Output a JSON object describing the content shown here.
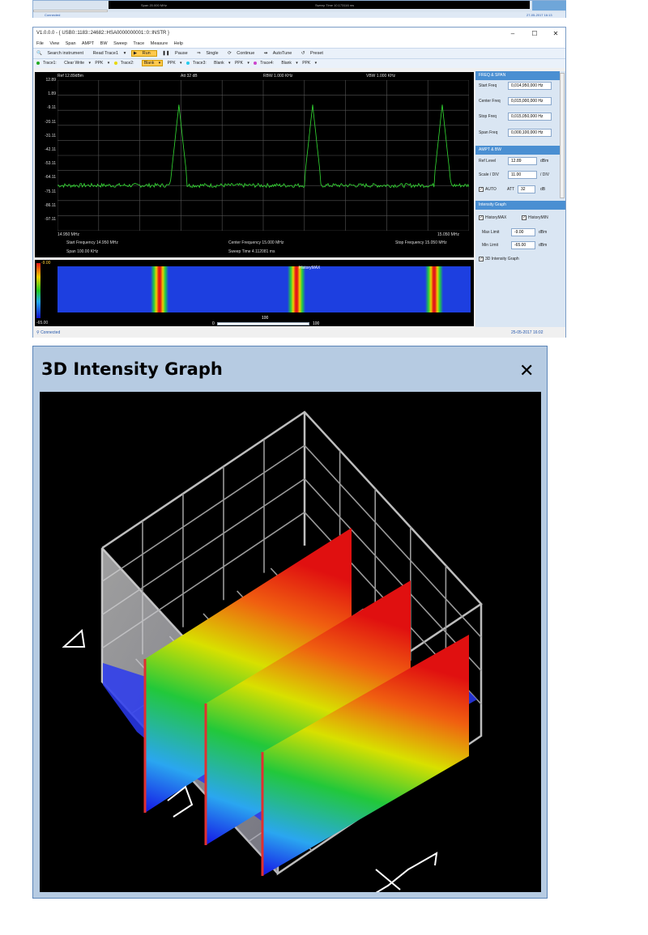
{
  "strip": {
    "span_text": "Span 20.000 MHz",
    "sweep_text": "Sweep Time 10.173116 ms",
    "connected": "Connected",
    "datetime": "27-05-2017 16:13"
  },
  "window": {
    "title": "V1.0.0.0  -  { USB0::1183::24682::HSA0000000001::0::INSTR }",
    "minimize": "–",
    "maximize": "☐",
    "close": "✕"
  },
  "menu": [
    "File",
    "View",
    "Span",
    "AMPT",
    "BW",
    "Sweep",
    "Trace",
    "Measure",
    "Help"
  ],
  "toolbar": {
    "search": "Search instrument",
    "read": "Read Trace1",
    "run": "Run",
    "pause": "Pause",
    "single": "Single",
    "continue": "Continue",
    "autotune": "AutoTune",
    "preset": "Preset"
  },
  "traces": [
    {
      "label": "Trace1:",
      "mode": "Clear Write",
      "det": "PPK",
      "color": "#22aa22"
    },
    {
      "label": "Trace2:",
      "mode": "Blank",
      "det": "PPK",
      "color": "#e8d800"
    },
    {
      "label": "Trace3:",
      "mode": "Blank",
      "det": "PPK",
      "color": "#22ccee"
    },
    {
      "label": "Trace4:",
      "mode": "Blank",
      "det": "PPK",
      "color": "#cc44cc"
    }
  ],
  "spectrum": {
    "ref": "Ref 12.89dBm",
    "att": "Att  32 dB",
    "rbw": "RBW 1.000 KHz",
    "vbw": "VBW 1.000 KHz",
    "y_labels": [
      "12.89",
      "1.89",
      "-9.11",
      "-20.11",
      "-31.11",
      "-42.11",
      "-53.11",
      "-64.11",
      "-75.11",
      "-86.11",
      "-97.11"
    ],
    "x_start": "14.950 MHz",
    "x_stop": "15.050 MHz",
    "start_freq": "Start Frequency  14.950 MHz",
    "span": "Span  100.00 KHz",
    "center_freq": "Center Frequency  15.000 MHz",
    "sweep_time": "Sweep Time  4.112081 ms",
    "stop_freq": "Stop Frequency  15.050 MHz"
  },
  "waterfall": {
    "max_label": "-9.00",
    "min_label": "-65.00",
    "history": "HistoryMAX",
    "slider_min": "0",
    "slider_val": "100",
    "slider_max": "100"
  },
  "side": {
    "freq_header": "FREQ & SPAN",
    "start_label": "Start Freq",
    "start_val": "0,014,950,000 Hz",
    "center_label": "Center Freq",
    "center_val": "0,015,000,000 Hz",
    "stop_label": "Stop Freq",
    "stop_val": "0,015,050,000 Hz",
    "span_label": "Span Freq",
    "span_val": "0,000,100,000 Hz",
    "ampt_header": "AMPT & BW",
    "ref_label": "Ref Level",
    "ref_val": "12.89",
    "ref_unit": "dBm",
    "scale_label": "Scale / DIV",
    "scale_val": "11.00",
    "scale_unit": "/ DIV",
    "auto_label": "AUTO",
    "att_label": "ATT",
    "att_val": "32",
    "att_unit": "dB",
    "ig_header": "Intensity Graph",
    "histmax": "HistoryMAX",
    "histmin": "HistoryMIN",
    "max_label": "Max Limit",
    "max_val": "-9.00",
    "max_unit": "dBm",
    "min_label": "Min Limit",
    "min_val": "-65.00",
    "min_unit": "dBm",
    "d3_label": "3D Intensity Graph"
  },
  "status": {
    "connected": "Connected",
    "datetime": "25-05-2017  16:02"
  },
  "d3window": {
    "title": "3D Intensity Graph",
    "close": "✕"
  },
  "colors": {
    "accent": "#4a8fd2",
    "trace": "#33dd33",
    "graph_bg": "#000000"
  }
}
